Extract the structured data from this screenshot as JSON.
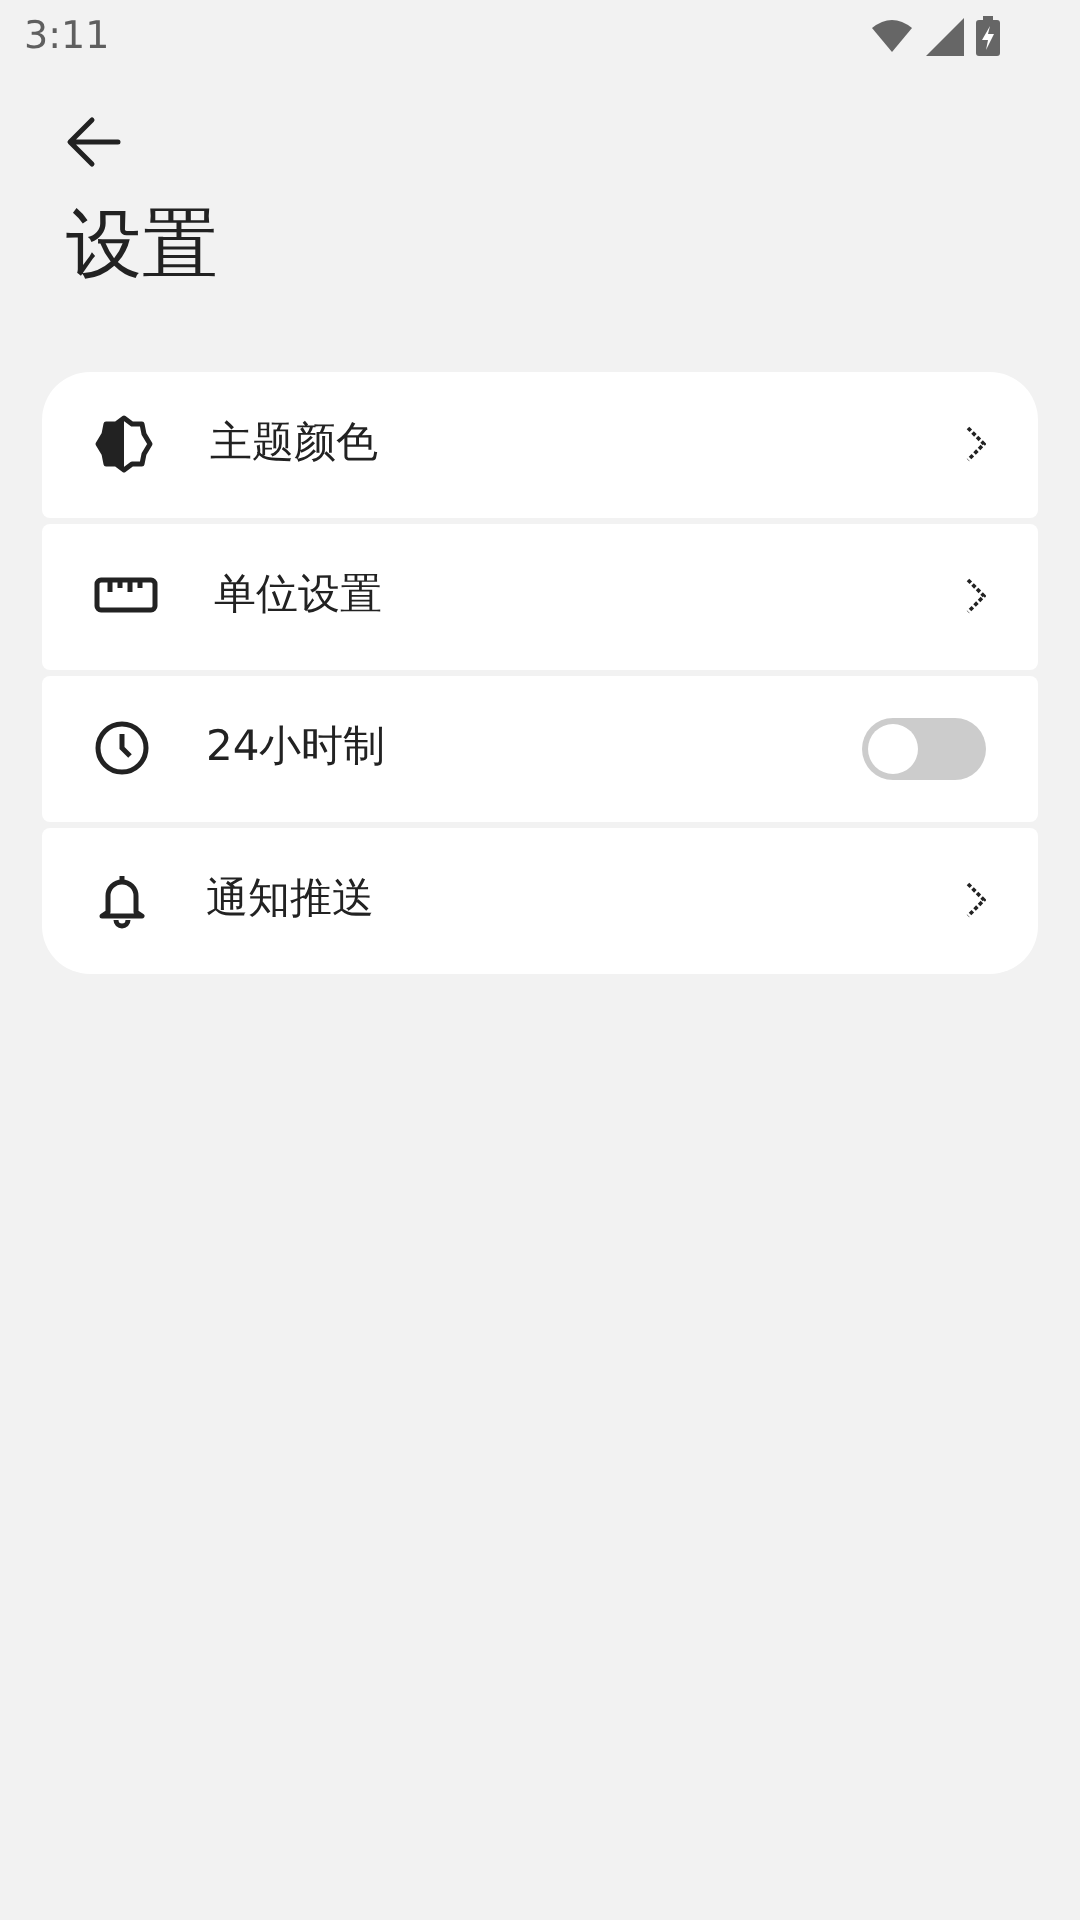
{
  "status_bar": {
    "time": "3:11"
  },
  "title": "设置",
  "items": [
    {
      "label": "主题颜色",
      "kind": "link"
    },
    {
      "label": "单位设置",
      "kind": "link"
    },
    {
      "label": "24小时制",
      "kind": "toggle",
      "on": false
    },
    {
      "label": "通知推送",
      "kind": "link"
    }
  ]
}
